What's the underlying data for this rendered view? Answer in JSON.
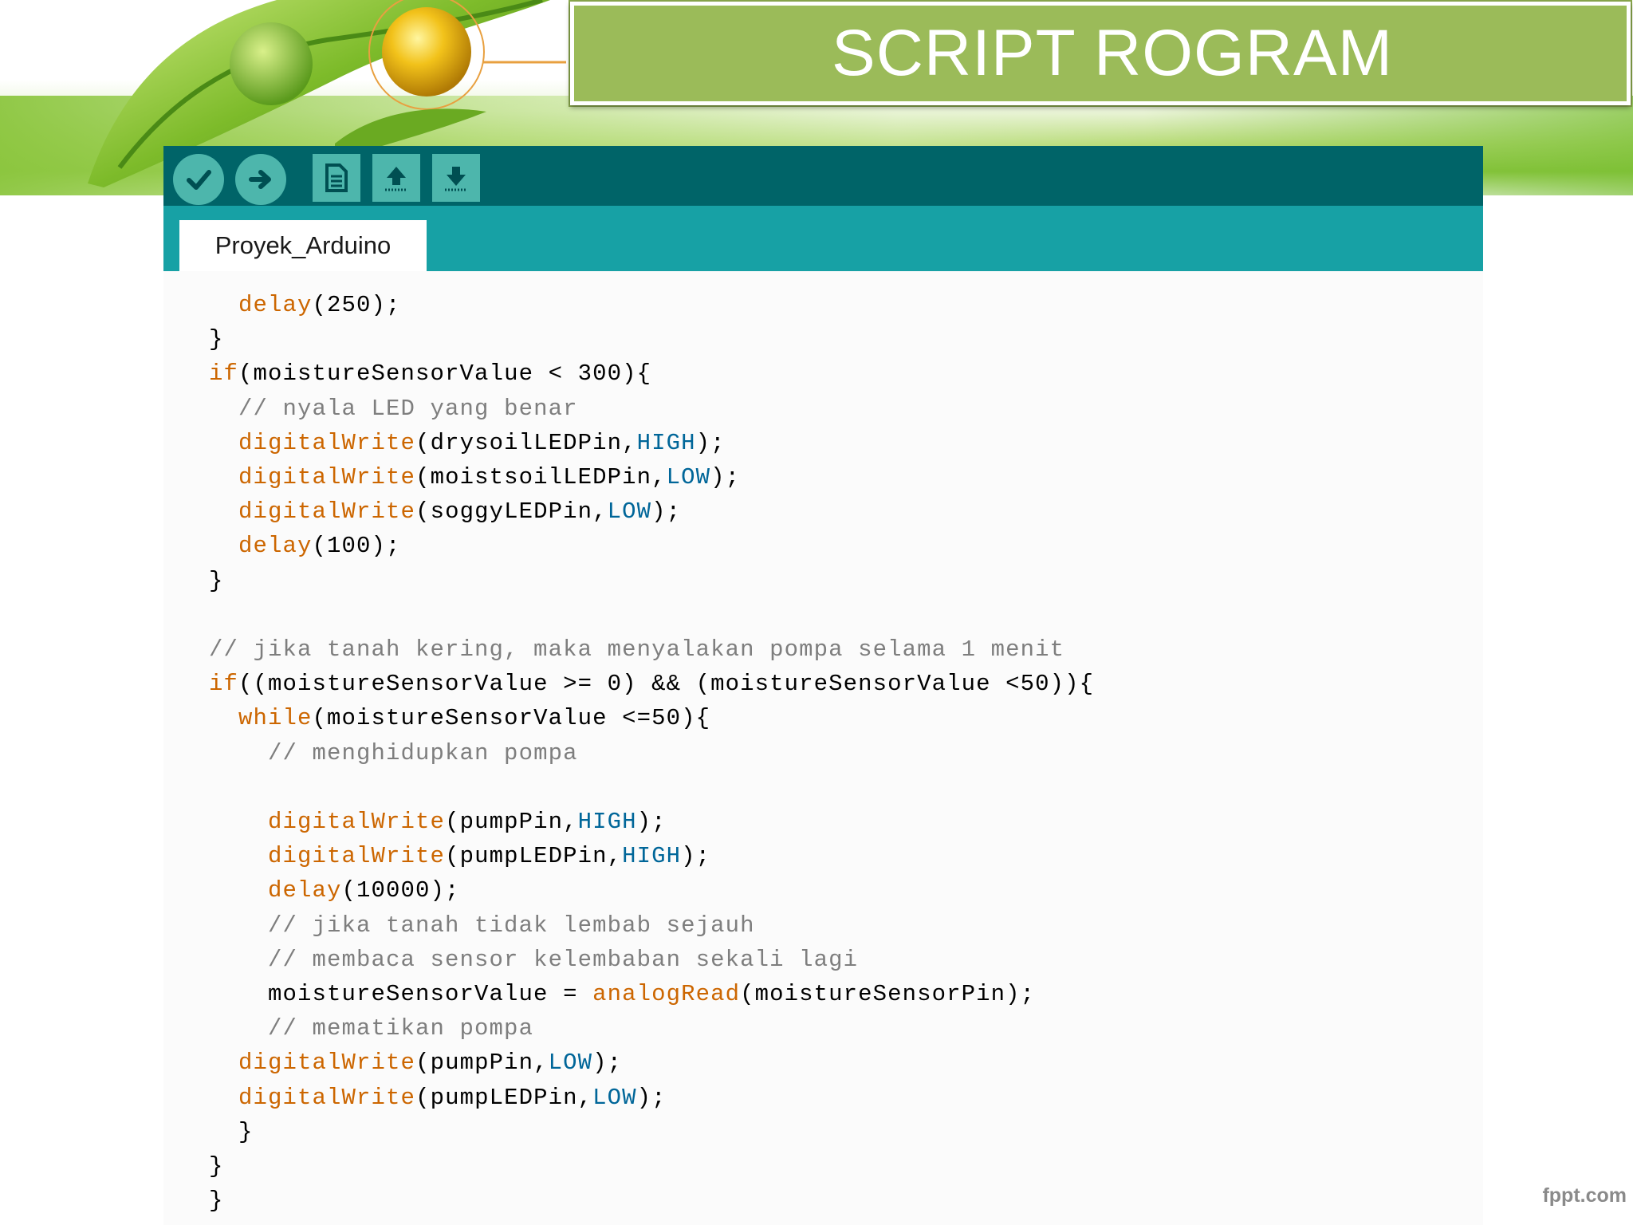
{
  "slide": {
    "title": "SCRIPT ROGRAM",
    "watermark": "fppt.com",
    "colors": {
      "title_bg": "#9bbb59",
      "toolbar": "#006468",
      "tabbar": "#17a1a5"
    }
  },
  "ide": {
    "toolbar": {
      "buttons": [
        {
          "icon": "checkmark-icon"
        },
        {
          "icon": "arrow-right-icon"
        },
        {
          "icon": "new-file-icon"
        },
        {
          "icon": "upload-arrow-icon"
        },
        {
          "icon": "download-arrow-icon"
        }
      ]
    },
    "tab": {
      "label": "Proyek_Arduino"
    },
    "code": [
      [
        {
          "t": "  "
        },
        {
          "c": "fn",
          "t": "delay"
        },
        {
          "t": "(250);"
        }
      ],
      [
        {
          "t": "}"
        }
      ],
      [
        {
          "c": "kw",
          "t": "if"
        },
        {
          "t": "(moistureSensorValue < 300){"
        }
      ],
      [
        {
          "t": "  "
        },
        {
          "c": "cm",
          "t": "// nyala LED yang benar"
        }
      ],
      [
        {
          "t": "  "
        },
        {
          "c": "fn",
          "t": "digitalWrite"
        },
        {
          "t": "(drysoilLEDPin,"
        },
        {
          "c": "cst",
          "t": "HIGH"
        },
        {
          "t": ");"
        }
      ],
      [
        {
          "t": "  "
        },
        {
          "c": "fn",
          "t": "digitalWrite"
        },
        {
          "t": "(moistsoilLEDPin,"
        },
        {
          "c": "cst",
          "t": "LOW"
        },
        {
          "t": ");"
        }
      ],
      [
        {
          "t": "  "
        },
        {
          "c": "fn",
          "t": "digitalWrite"
        },
        {
          "t": "(soggyLEDPin,"
        },
        {
          "c": "cst",
          "t": "LOW"
        },
        {
          "t": ");"
        }
      ],
      [
        {
          "t": "  "
        },
        {
          "c": "fn",
          "t": "delay"
        },
        {
          "t": "(100);"
        }
      ],
      [
        {
          "t": "}"
        }
      ],
      [
        {
          "t": ""
        }
      ],
      [
        {
          "c": "cm",
          "t": "// jika tanah kering, maka menyalakan pompa selama 1 menit"
        }
      ],
      [
        {
          "c": "kw",
          "t": "if"
        },
        {
          "t": "((moistureSensorValue >= 0) && (moistureSensorValue <50)){"
        }
      ],
      [
        {
          "t": "  "
        },
        {
          "c": "kw",
          "t": "while"
        },
        {
          "t": "(moistureSensorValue <=50){"
        }
      ],
      [
        {
          "t": "    "
        },
        {
          "c": "cm",
          "t": "// menghidupkan pompa"
        }
      ],
      [
        {
          "t": ""
        }
      ],
      [
        {
          "t": "    "
        },
        {
          "c": "fn",
          "t": "digitalWrite"
        },
        {
          "t": "(pumpPin,"
        },
        {
          "c": "cst",
          "t": "HIGH"
        },
        {
          "t": ");"
        }
      ],
      [
        {
          "t": "    "
        },
        {
          "c": "fn",
          "t": "digitalWrite"
        },
        {
          "t": "(pumpLEDPin,"
        },
        {
          "c": "cst",
          "t": "HIGH"
        },
        {
          "t": ");"
        }
      ],
      [
        {
          "t": "    "
        },
        {
          "c": "fn",
          "t": "delay"
        },
        {
          "t": "(10000);"
        }
      ],
      [
        {
          "t": "    "
        },
        {
          "c": "cm",
          "t": "// jika tanah tidak lembab sejauh"
        }
      ],
      [
        {
          "t": "    "
        },
        {
          "c": "cm",
          "t": "// membaca sensor kelembaban sekali lagi"
        }
      ],
      [
        {
          "t": "    moistureSensorValue = "
        },
        {
          "c": "fn",
          "t": "analogRead"
        },
        {
          "t": "(moistureSensorPin);"
        }
      ],
      [
        {
          "t": "    "
        },
        {
          "c": "cm",
          "t": "// mematikan pompa"
        }
      ],
      [
        {
          "t": "  "
        },
        {
          "c": "fn",
          "t": "digitalWrite"
        },
        {
          "t": "(pumpPin,"
        },
        {
          "c": "cst",
          "t": "LOW"
        },
        {
          "t": ");"
        }
      ],
      [
        {
          "t": "  "
        },
        {
          "c": "fn",
          "t": "digitalWrite"
        },
        {
          "t": "(pumpLEDPin,"
        },
        {
          "c": "cst",
          "t": "LOW"
        },
        {
          "t": ");"
        }
      ],
      [
        {
          "t": "  }"
        }
      ],
      [
        {
          "t": "}"
        }
      ],
      [
        {
          "t": "}"
        }
      ]
    ]
  }
}
